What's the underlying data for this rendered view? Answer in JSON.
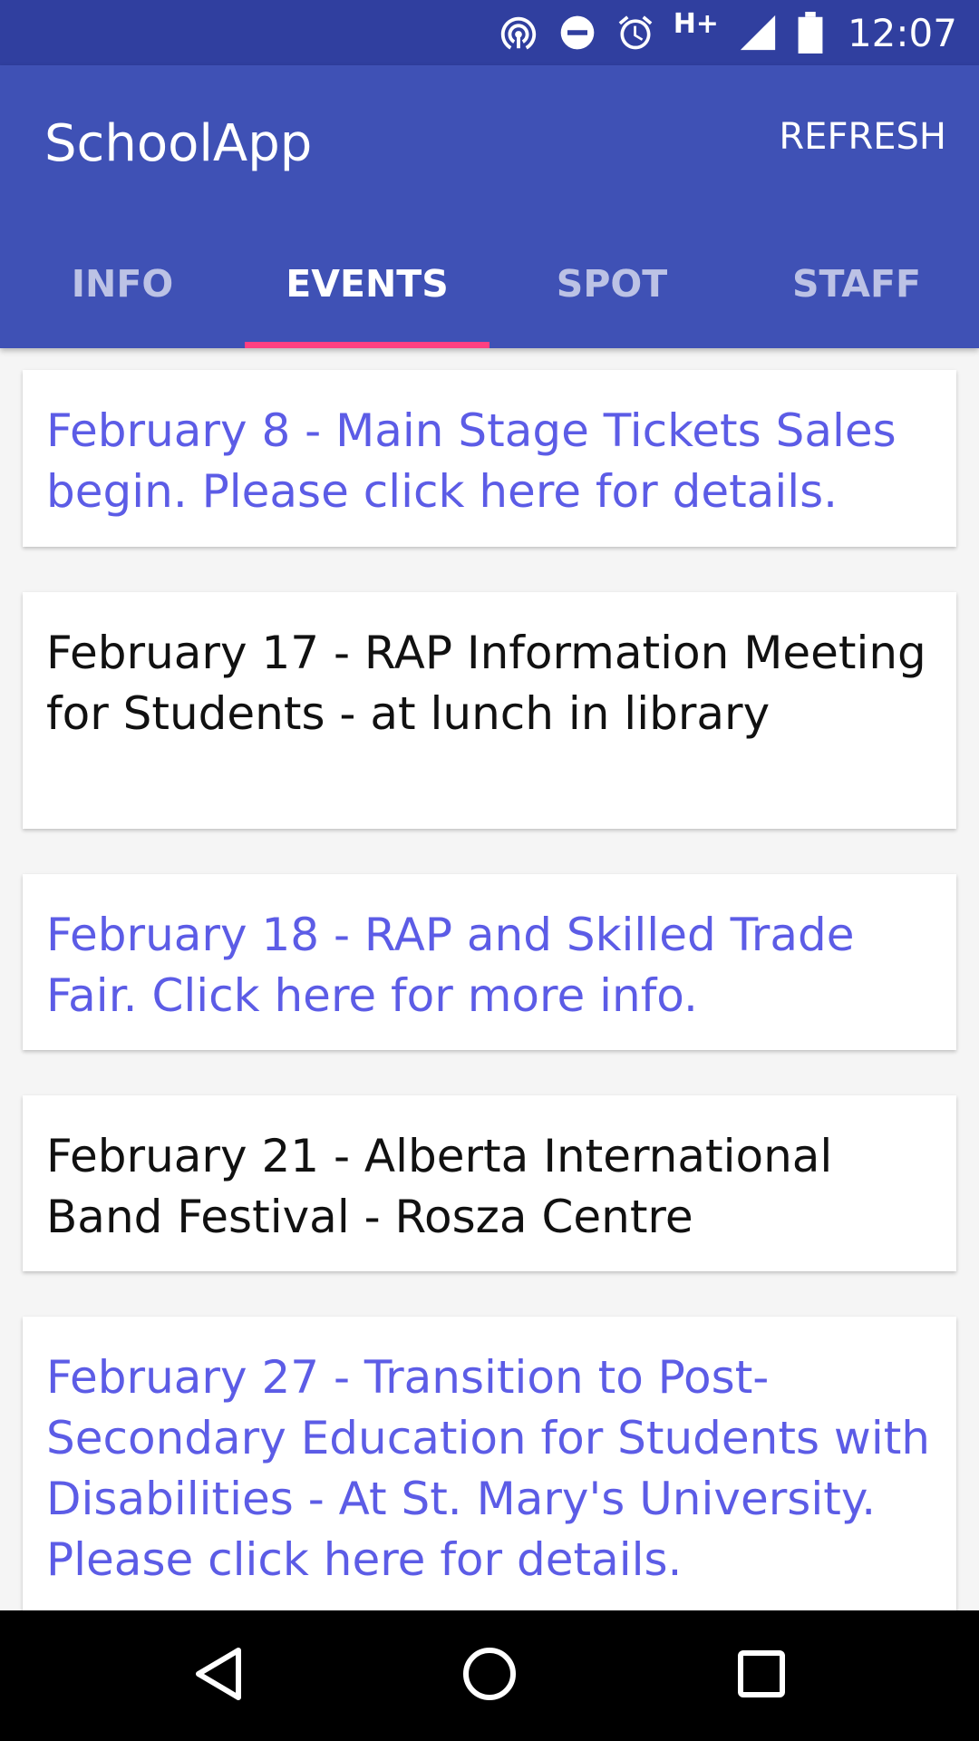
{
  "status_bar": {
    "time": "12:07",
    "network_label": "H+",
    "icons": [
      "hotspot-icon",
      "do-not-disturb-icon",
      "alarm-icon",
      "signal-icon",
      "battery-icon"
    ]
  },
  "app_bar": {
    "title": "SchoolApp",
    "refresh_label": "REFRESH",
    "colors": {
      "primary": "#3f51b5",
      "primary_dark": "#303f9f",
      "accent": "#ff4081"
    }
  },
  "tabs": [
    {
      "label": "INFO",
      "active": false
    },
    {
      "label": "EVENTS",
      "active": true
    },
    {
      "label": "SPOT",
      "active": false
    },
    {
      "label": "STAFF",
      "active": false
    }
  ],
  "events": [
    {
      "text": "February 8 - Main Stage Tickets Sales begin. Please click here for details.",
      "is_link": true
    },
    {
      "text": "February 17 - RAP Information Meeting for Students - at lunch in library",
      "is_link": false
    },
    {
      "text": "February 18 - RAP and Skilled Trade Fair. Click here for more info.",
      "is_link": true
    },
    {
      "text": "February 21 - Alberta International Band Festival - Rosza Centre",
      "is_link": false
    },
    {
      "text": "February 27 - Transition to Post-Secondary Education for Students with Disabilities - At St. Mary's University. Please click here for details.",
      "is_link": true
    }
  ],
  "nav_bar": {
    "icons": [
      "back-icon",
      "home-icon",
      "recents-icon"
    ]
  }
}
